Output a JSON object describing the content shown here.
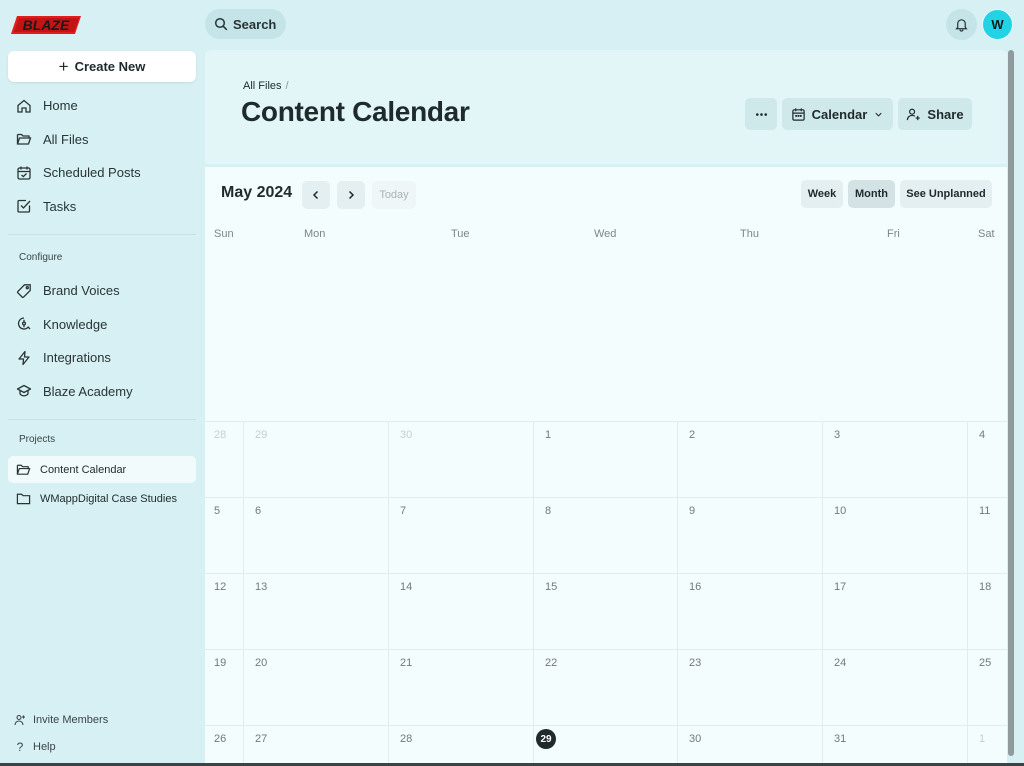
{
  "brand": {
    "logo_text": "BLAZE",
    "accent": "#e11d1d"
  },
  "sidebar": {
    "create_label": "Create New",
    "nav": [
      {
        "label": "Home",
        "icon": "home-icon"
      },
      {
        "label": "All Files",
        "icon": "folder-open-icon"
      },
      {
        "label": "Scheduled Posts",
        "icon": "calendar-check-icon"
      },
      {
        "label": "Tasks",
        "icon": "checkbox-icon"
      }
    ],
    "configure_label": "Configure",
    "configure": [
      {
        "label": "Brand Voices",
        "icon": "tag-icon"
      },
      {
        "label": "Knowledge",
        "icon": "brain-icon"
      },
      {
        "label": "Integrations",
        "icon": "bolt-icon"
      },
      {
        "label": "Blaze Academy",
        "icon": "graduation-cap-icon"
      }
    ],
    "projects_label": "Projects",
    "projects": [
      {
        "label": "Content Calendar",
        "active": true
      },
      {
        "label": "WMappDigital Case Studies",
        "active": false
      }
    ],
    "invite_label": "Invite Members",
    "help_label": "Help"
  },
  "topbar": {
    "search_label": "Search",
    "avatar_initial": "W"
  },
  "header": {
    "breadcrumb": "All Files",
    "breadcrumb_sep": "/",
    "title": "Content Calendar",
    "view_select": "Calendar",
    "share_label": "Share"
  },
  "calendar": {
    "month_label": "May 2024",
    "today_label": "Today",
    "views": [
      "Week",
      "Month",
      "See Unplanned"
    ],
    "active_view": "Month",
    "weekdays": [
      "Sun",
      "Mon",
      "Tue",
      "Wed",
      "Thu",
      "Fri",
      "Sat"
    ],
    "weeks": [
      [
        "28",
        "29",
        "30",
        "1",
        "2",
        "3",
        "4"
      ],
      [
        "5",
        "6",
        "7",
        "8",
        "9",
        "10",
        "11"
      ],
      [
        "12",
        "13",
        "14",
        "15",
        "16",
        "17",
        "18"
      ],
      [
        "19",
        "20",
        "21",
        "22",
        "23",
        "24",
        "25"
      ],
      [
        "26",
        "27",
        "28",
        "29",
        "30",
        "31",
        "1"
      ]
    ],
    "faded_days": [
      [
        0,
        0
      ],
      [
        0,
        1
      ],
      [
        0,
        2
      ],
      [
        4,
        6
      ]
    ],
    "today_day": "29"
  }
}
